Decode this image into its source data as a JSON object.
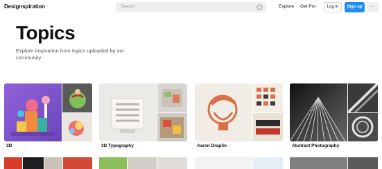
{
  "header": {
    "logo": "Designspiration",
    "search_placeholder": "Search",
    "nav": {
      "explore": "Explore",
      "get_pro": "Get Pro"
    },
    "login_label": "Log in",
    "signup_label": "Sign up",
    "more_label": "···"
  },
  "page": {
    "title": "Topics",
    "description": "Explore inspiration from topics uploaded by our community."
  },
  "topics": [
    {
      "label": "3D"
    },
    {
      "label": "3D Typography"
    },
    {
      "label": "Aaron Draplin"
    },
    {
      "label": "Abstract Photography"
    }
  ],
  "colors": {
    "accent": "#1f8ef1",
    "search_bg": "#efefef",
    "text": "#111111"
  }
}
